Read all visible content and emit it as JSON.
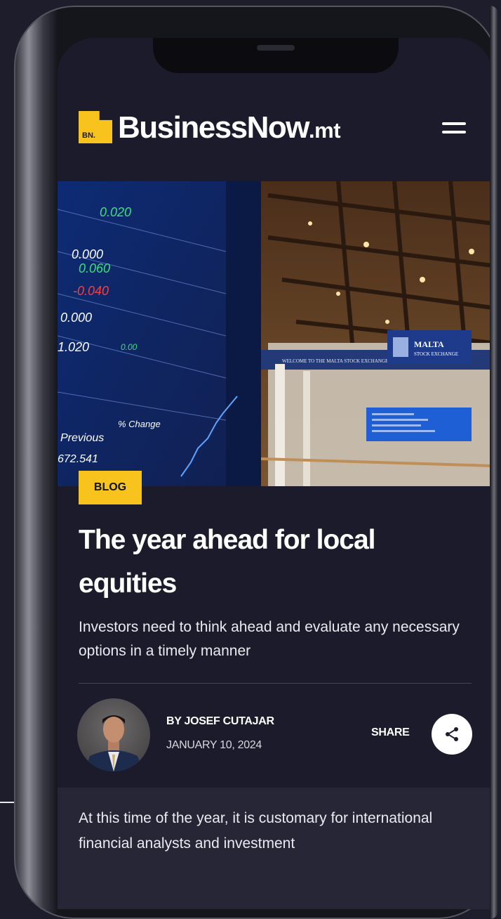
{
  "header": {
    "logo_badge": "BN.",
    "brand_main": "BusinessNow",
    "brand_tld": ".mt",
    "menu_icon": "hamburger-menu-icon"
  },
  "hero": {
    "sign_line1": "MALTA",
    "sign_line2": "STOCK EXCHANGE",
    "welcome_banner": "WELCOME TO THE MALTA STOCK EXCHANGE",
    "board_values": [
      "0.020",
      "0.000",
      "0.060",
      "-0.040",
      "0.000",
      "1.020"
    ],
    "board_label_previous": "Previous",
    "board_label_change": "% Change",
    "board_price": "672.541",
    "board_small": "0.00"
  },
  "article": {
    "category": "BLOG",
    "title": "The year ahead for local equities",
    "subtitle": "Investors need to think ahead and evaluate any necessary options in a timely manner",
    "author": "BY JOSEF CUTAJAR",
    "date": "JANUARY 10, 2024",
    "share_label": "SHARE",
    "share_icon": "share-icon",
    "body_excerpt": "At this time of the year, it is customary for international financial analysts and investment"
  },
  "colors": {
    "accent": "#f7c31c",
    "page_bg": "#1d1d2c",
    "screen_bg": "#1b1b2b",
    "body_block_bg": "#262637"
  }
}
